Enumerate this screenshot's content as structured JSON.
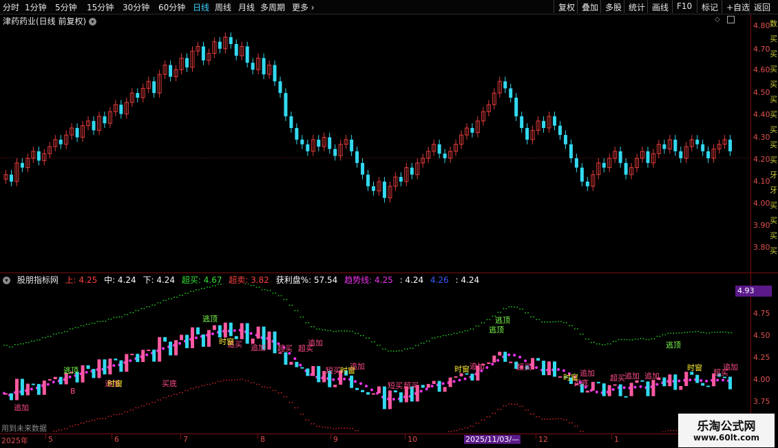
{
  "toolbar": {
    "periods": [
      "分时",
      "1分钟",
      "5分钟",
      "15分钟",
      "30分钟",
      "60分钟",
      "日线",
      "周线",
      "月线",
      "多周期",
      "更多"
    ],
    "active_period": "日线",
    "right_buttons": [
      "复权",
      "叠加",
      "多股",
      "统计",
      "画线",
      "F10",
      "标记",
      "+自选",
      "返回"
    ]
  },
  "main_chart": {
    "title": "津药药业(日线 前复权)",
    "price_ticks": [
      "4.80",
      "4.70",
      "4.60",
      "4.50",
      "4.40",
      "4.30",
      "4.20",
      "4.10",
      "4.00",
      "3.90",
      "3.80"
    ],
    "price_range": [
      3.73,
      4.84
    ]
  },
  "indicator": {
    "name": "股朋指标网",
    "upper_label": "上: 4.25",
    "mid_label": "中: 4.24",
    "lower_label": "下: 4.24",
    "overbuy_label": "超买: 4.67",
    "oversell_label": "超卖: 3.82",
    "profit_label": "获利盘%: 57.54",
    "trend_label": "趋势线: 4.25",
    "extra1": ": 4.24",
    "extra2": "4.26",
    "extra3": ": 4.24",
    "current_value": "4.93",
    "ticks": [
      "4.75",
      "4.50",
      "4.25",
      "4.00",
      "3.75"
    ],
    "range": [
      3.66,
      4.96
    ],
    "footer_note": "用到未来数据"
  },
  "time_axis": {
    "labels": [
      "2025年",
      "5",
      "6",
      "7",
      "8",
      "9",
      "10",
      "2025/11/03/—",
      "12",
      "1"
    ],
    "highlight": "2025/11/03/—"
  },
  "signals": {
    "zhuijia": "追加",
    "taoding": "逃顶",
    "chaomai": "超买",
    "duanmai": "短买",
    "maidi": "买底",
    "shichuang": "时窗",
    "zhuimai": "追买",
    "b": "B"
  },
  "right_strip_text": "数买买买买买买买买买牙牙买买买买",
  "watermark": {
    "title": "乐淘公式网",
    "url": "www.60lt.com"
  },
  "colors": {
    "up": "#e23b3b",
    "down": "#33d9f0",
    "axis": "#e05050",
    "trend": "#ee33ee",
    "upper_band": "#22cc22",
    "lower_band": "#cc2222"
  },
  "candles": [
    4.15,
    4.12,
    4.2,
    4.18,
    4.22,
    4.25,
    4.21,
    4.24,
    4.27,
    4.3,
    4.28,
    4.32,
    4.35,
    4.31,
    4.36,
    4.38,
    4.34,
    4.4,
    4.37,
    4.42,
    4.45,
    4.41,
    4.46,
    4.5,
    4.48,
    4.52,
    4.55,
    4.5,
    4.58,
    4.62,
    4.57,
    4.6,
    4.65,
    4.61,
    4.68,
    4.7,
    4.64,
    4.67,
    4.72,
    4.69,
    4.74,
    4.71,
    4.66,
    4.7,
    4.63,
    4.6,
    4.65,
    4.58,
    4.62,
    4.55,
    4.5,
    4.4,
    4.35,
    4.3,
    4.28,
    4.25,
    4.3,
    4.27,
    4.31,
    4.26,
    4.23,
    4.28,
    4.3,
    4.25,
    4.2,
    4.15,
    4.1,
    4.08,
    4.12,
    4.05,
    4.1,
    4.14,
    4.12,
    4.18,
    4.15,
    4.2,
    4.22,
    4.25,
    4.28,
    4.24,
    4.22,
    4.25,
    4.28,
    4.32,
    4.35,
    4.33,
    4.38,
    4.42,
    4.45,
    4.5,
    4.55,
    4.52,
    4.48,
    4.4,
    4.35,
    4.3,
    4.34,
    4.38,
    4.35,
    4.4,
    4.36,
    4.32,
    4.28,
    4.22,
    4.18,
    4.12,
    4.1,
    4.15,
    4.2,
    4.18,
    4.22,
    4.25,
    4.2,
    4.15,
    4.18,
    4.22,
    4.25,
    4.2,
    4.24,
    4.28,
    4.26,
    4.3,
    4.25,
    4.22,
    4.27,
    4.3,
    4.28,
    4.25,
    4.22,
    4.26,
    4.28,
    4.3,
    4.25
  ]
}
